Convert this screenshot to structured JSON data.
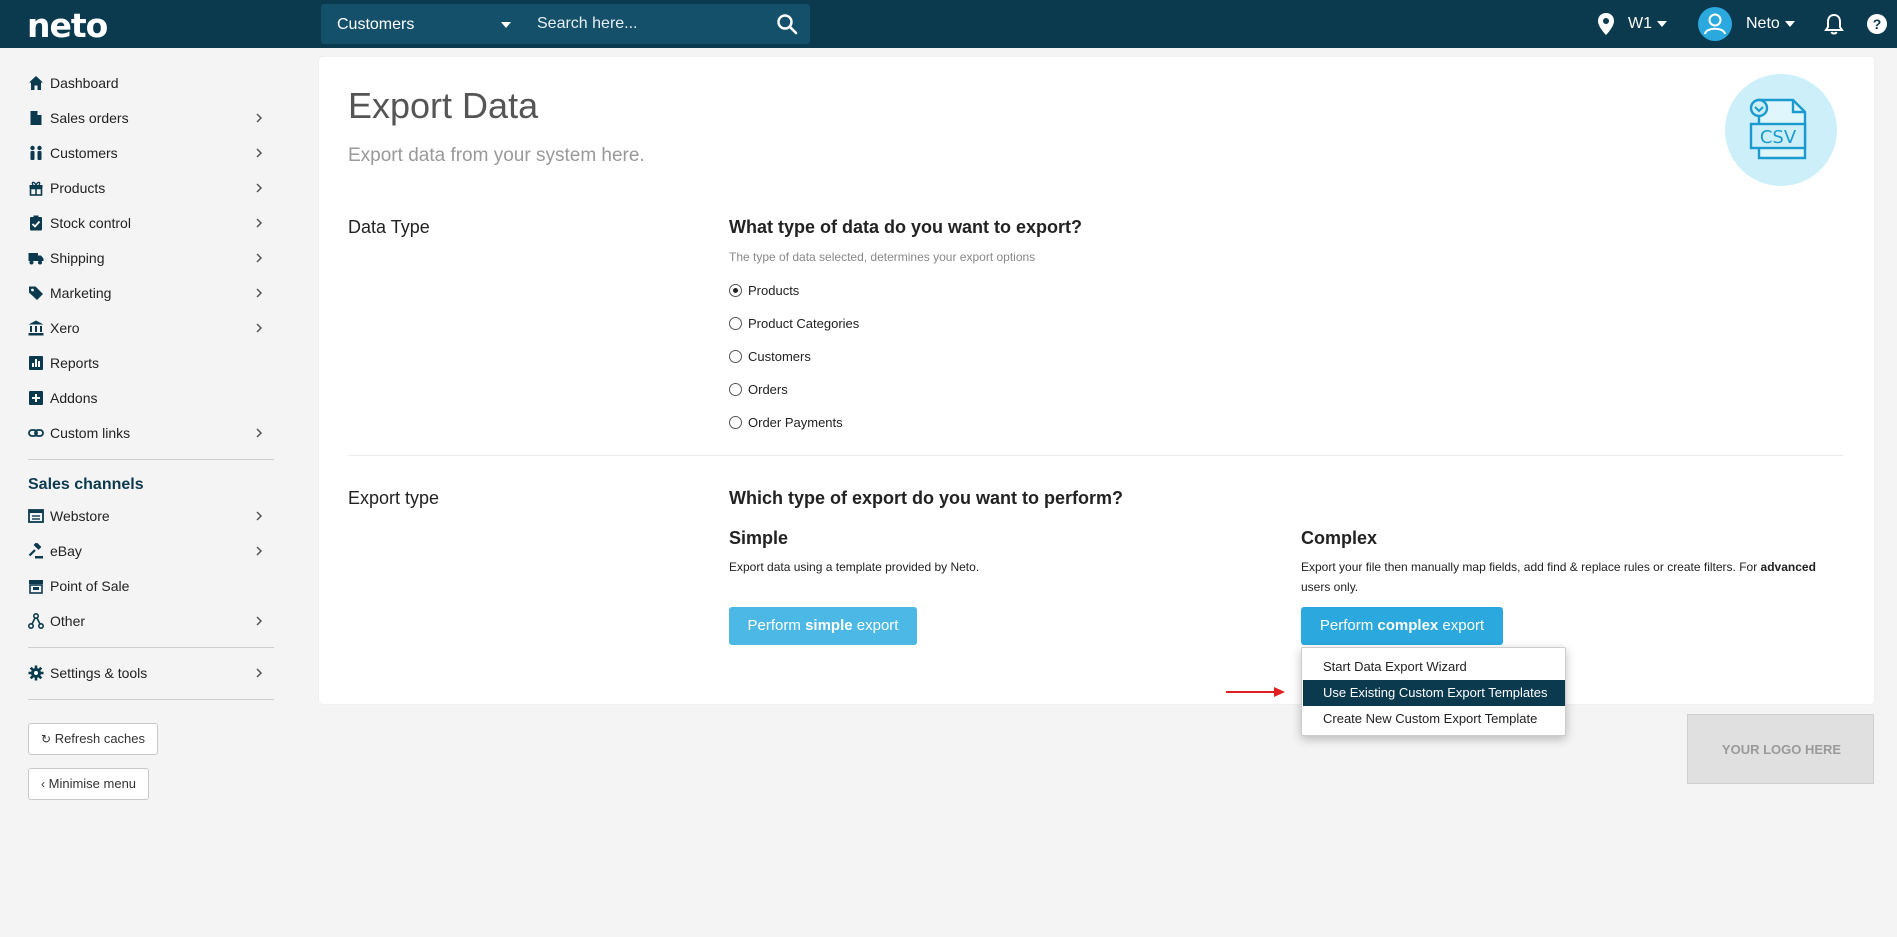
{
  "topbar": {
    "logo": "neto",
    "search_scope": "Customers",
    "search_placeholder": "Search here...",
    "location": "W1",
    "user": "Neto"
  },
  "sidebar": {
    "items": [
      {
        "label": "Dashboard",
        "icon": "home-icon",
        "has_children": false
      },
      {
        "label": "Sales orders",
        "icon": "document-icon",
        "has_children": true
      },
      {
        "label": "Customers",
        "icon": "customers-icon",
        "has_children": true
      },
      {
        "label": "Products",
        "icon": "gift-icon",
        "has_children": true
      },
      {
        "label": "Stock control",
        "icon": "clipboard-check-icon",
        "has_children": true
      },
      {
        "label": "Shipping",
        "icon": "truck-icon",
        "has_children": true
      },
      {
        "label": "Marketing",
        "icon": "tag-icon",
        "has_children": true
      },
      {
        "label": "Xero",
        "icon": "bank-icon",
        "has_children": true
      },
      {
        "label": "Reports",
        "icon": "bar-chart-icon",
        "has_children": false
      },
      {
        "label": "Addons",
        "icon": "plus-square-icon",
        "has_children": false
      },
      {
        "label": "Custom links",
        "icon": "link-icon",
        "has_children": true
      }
    ],
    "channels_heading": "Sales channels",
    "channels": [
      {
        "label": "Webstore",
        "icon": "window-icon",
        "has_children": true
      },
      {
        "label": "eBay",
        "icon": "gavel-icon",
        "has_children": true
      },
      {
        "label": "Point of Sale",
        "icon": "store-icon",
        "has_children": false
      },
      {
        "label": "Other",
        "icon": "network-icon",
        "has_children": true
      }
    ],
    "settings": {
      "label": "Settings & tools",
      "icon": "gear-icon",
      "has_children": true
    },
    "refresh_label": "Refresh caches",
    "minimise_label": "Minimise menu"
  },
  "main": {
    "title": "Export Data",
    "subtitle": "Export data from your system here.",
    "badge_text": "CSV",
    "data_type": {
      "label": "Data Type",
      "question": "What type of data do you want to export?",
      "help": "The type of data selected, determines your export options",
      "options": [
        "Products",
        "Product Categories",
        "Customers",
        "Orders",
        "Order Payments"
      ],
      "selected": "Products"
    },
    "export_type": {
      "label": "Export type",
      "question": "Which type of export do you want to perform?",
      "simple": {
        "title": "Simple",
        "desc": "Export data using a template provided by Neto.",
        "btn_pre": "Perform ",
        "btn_bold": "simple",
        "btn_post": " export"
      },
      "complex": {
        "title": "Complex",
        "desc_pre": "Export your file then manually map fields, add find & replace rules or create filters. For ",
        "desc_bold": "advanced",
        "desc_post": " users only.",
        "btn_pre": "Perform ",
        "btn_bold": "complex",
        "btn_post": " export"
      }
    },
    "dropdown": [
      "Start Data Export Wizard",
      "Use Existing Custom Export Templates",
      "Create New Custom Export Template"
    ],
    "dropdown_active": "Use Existing Custom Export Templates",
    "logo_placeholder": "YOUR LOGO HERE"
  },
  "colors": {
    "topbar": "#0b3a4f",
    "search_bg": "#15506b",
    "accent": "#2ba9de",
    "simple_btn": "#4cb8e6",
    "arrow": "#e02020"
  }
}
